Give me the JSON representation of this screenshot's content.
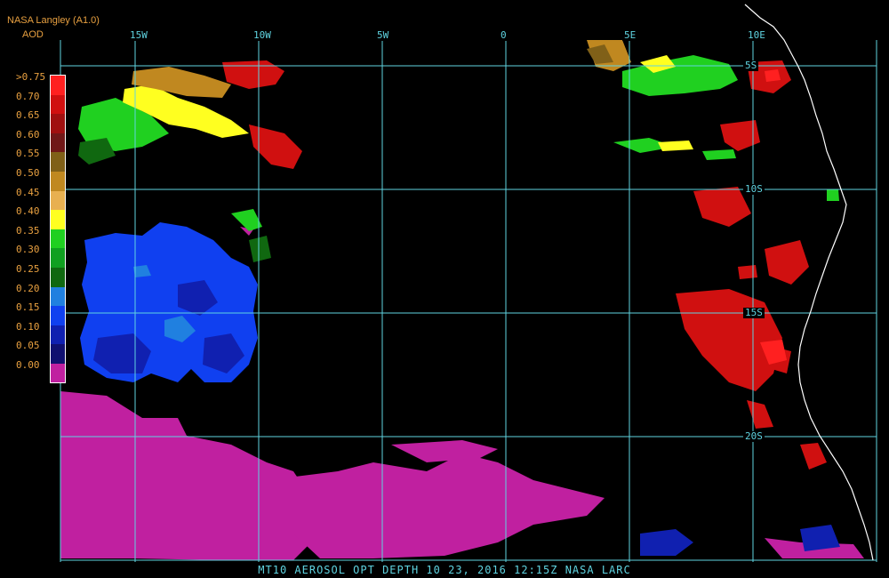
{
  "header": {
    "title": "NASA Langley (A1.0)",
    "subtitle": "AOD"
  },
  "legend": {
    "labels": [
      ">0.75",
      "0.70",
      "0.65",
      "0.60",
      "0.55",
      "0.50",
      "0.45",
      "0.40",
      "0.35",
      "0.30",
      "0.25",
      "0.20",
      "0.15",
      "0.10",
      "0.05",
      "0.00"
    ],
    "colors": [
      "#ff2020",
      "#d01010",
      "#a01010",
      "#701818",
      "#806018",
      "#c08820",
      "#e8b050",
      "#ffff20",
      "#20d020",
      "#10a020",
      "#106810",
      "#2080e0",
      "#1040f0",
      "#1020b0",
      "#101070",
      "#c020a0"
    ]
  },
  "grid": {
    "lon_labels": [
      "15W",
      "10W",
      "5W",
      "0",
      "5E",
      "10E"
    ],
    "lat_labels": [
      "5S",
      "10S",
      "15S",
      "20S"
    ]
  },
  "footer": {
    "caption": "MT10   AEROSOL OPT DEPTH   10 23, 2016 12:15Z   NASA LARC"
  },
  "colors": {
    "grid": "#5fd3e0",
    "coast": "#ffffff",
    "header": "#e8a040"
  }
}
